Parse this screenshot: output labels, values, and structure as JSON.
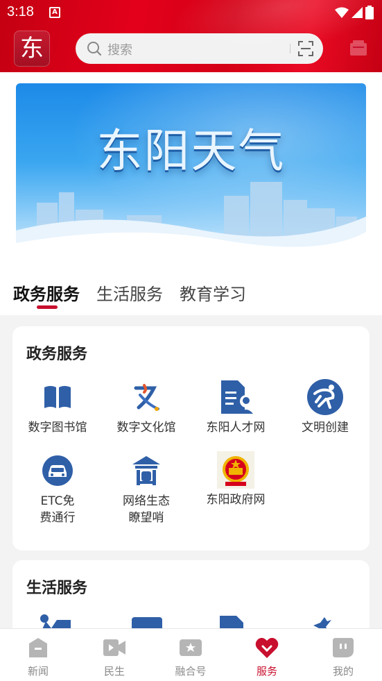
{
  "status_bar": {
    "time": "3:18",
    "notification_icon": "A"
  },
  "header": {
    "logo_char": "东",
    "search": {
      "placeholder": "搜索"
    },
    "icons": [
      "search-icon",
      "scan-icon",
      "message-icon"
    ]
  },
  "banner": {
    "title": "东阳天气"
  },
  "tabs": [
    {
      "label": "政务服务",
      "active": true
    },
    {
      "label": "生活服务",
      "active": false
    },
    {
      "label": "教育学习",
      "active": false
    }
  ],
  "sections": [
    {
      "title": "政务服务",
      "items": [
        {
          "label": "数字图书馆",
          "icon": "book-icon"
        },
        {
          "label": "数字文化馆",
          "icon": "culture-logo-icon"
        },
        {
          "label": "东阳人才网",
          "icon": "talent-document-icon"
        },
        {
          "label": "文明创建",
          "icon": "civilization-runner-icon"
        },
        {
          "label": "ETC免\n费通行",
          "icon": "car-icon"
        },
        {
          "label": "网络生态\n瞭望哨",
          "icon": "watchtower-icon"
        },
        {
          "label": "东阳政府网",
          "icon": "national-emblem-icon"
        }
      ]
    },
    {
      "title": "生活服务",
      "items": []
    }
  ],
  "bottom_nav": [
    {
      "label": "新闻",
      "icon": "news-icon",
      "active": false
    },
    {
      "label": "民生",
      "icon": "video-icon",
      "active": false
    },
    {
      "label": "融合号",
      "icon": "star-badge-icon",
      "active": false
    },
    {
      "label": "服务",
      "icon": "heart-icon",
      "active": true
    },
    {
      "label": "我的",
      "icon": "profile-icon",
      "active": false
    }
  ],
  "colors": {
    "brand_red": "#c8102e",
    "header_red": "#e3001b",
    "icon_blue": "#2f5fa7"
  }
}
